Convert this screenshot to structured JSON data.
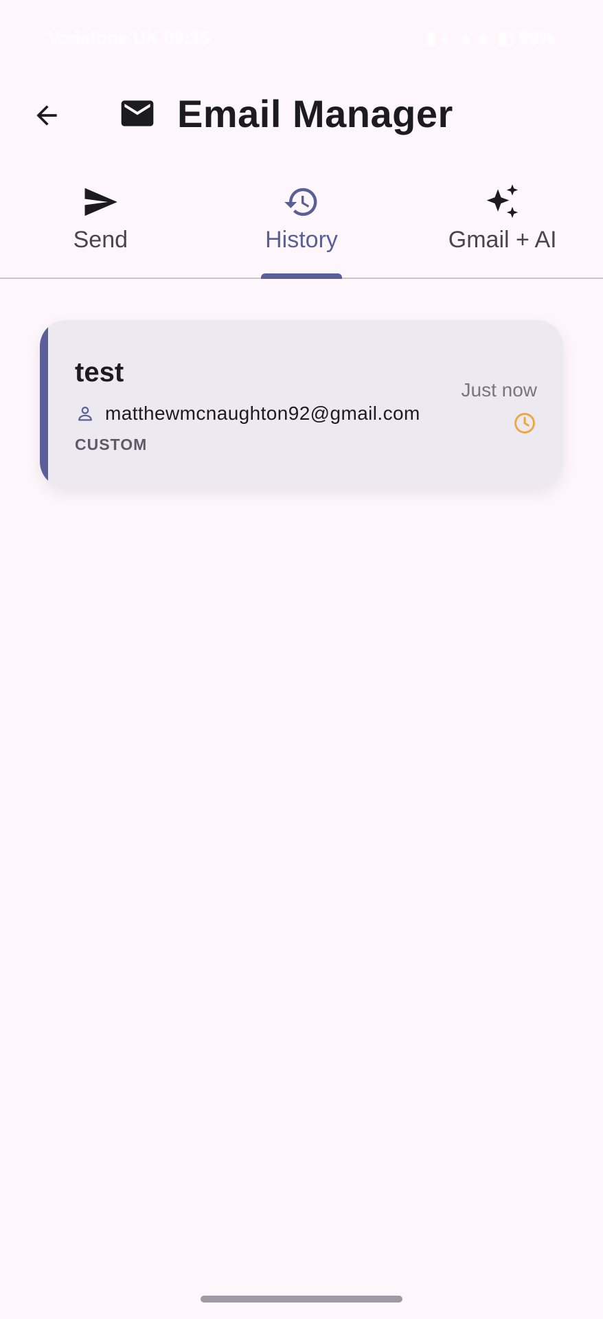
{
  "statusbar": {
    "left_text": "Vodafone UK 09:35",
    "right_text": "▮ ◐ ▲▲ ◧ 99%"
  },
  "appbar": {
    "title": "Email Manager",
    "back_icon": "arrow-back-icon",
    "title_icon": "mail-icon"
  },
  "tabs": [
    {
      "label": "Send",
      "icon": "send-icon",
      "active": false
    },
    {
      "label": "History",
      "icon": "history-icon",
      "active": true
    },
    {
      "label": "Gmail + AI",
      "icon": "sparkles-icon",
      "active": false
    }
  ],
  "history": {
    "items": [
      {
        "subject": "test",
        "recipient": "matthewmcnaughton92@gmail.com",
        "category": "CUSTOM",
        "time": "Just now",
        "status_icon": "clock-icon"
      }
    ]
  },
  "colors": {
    "accent": "#5b5f97",
    "background": "#fdf7fc",
    "card": "#ece9f0",
    "pending": "#f2a33a"
  }
}
